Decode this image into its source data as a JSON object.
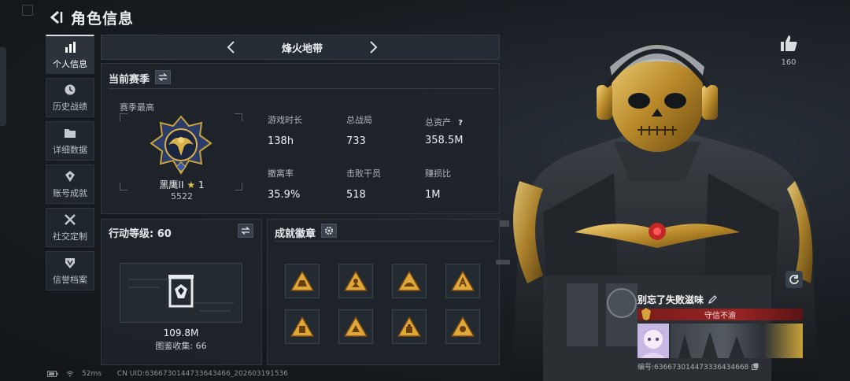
{
  "header": {
    "title": "角色信息"
  },
  "nav": {
    "items": [
      {
        "label": "个人信息"
      },
      {
        "label": "历史战绩"
      },
      {
        "label": "详细数据"
      },
      {
        "label": "账号成就"
      },
      {
        "label": "社交定制"
      },
      {
        "label": "信誉档案"
      }
    ]
  },
  "season": {
    "map_name": "烽火地带",
    "current_label": "当前赛季",
    "best_label": "赛季最高",
    "rank_name": "黑鹰II",
    "rank_stars": "1",
    "rank_score": "5522",
    "stats": [
      {
        "label": "游戏时长",
        "value": "138h"
      },
      {
        "label": "总战局",
        "value": "733"
      },
      {
        "label": "总资产",
        "value": "358.5M"
      },
      {
        "label": "撤离率",
        "value": "35.9%"
      },
      {
        "label": "击败干员",
        "value": "518"
      },
      {
        "label": "赚损比",
        "value": "1M"
      }
    ]
  },
  "action_level": {
    "title": "行动等级: 60",
    "value": "109.8M",
    "collection": "图鉴收集: 66"
  },
  "achievements": {
    "title": "成就徽章",
    "count": 8
  },
  "like": {
    "count": "160"
  },
  "player": {
    "name": "别忘了失败滋味",
    "title": "守信不渝",
    "id": "编号:636673014473336434668"
  },
  "status": {
    "ping": "52ms",
    "uid": "CN UID:6366730144733643466_202603191536"
  },
  "colors": {
    "accent_gold": "#c9a23a",
    "strip_red": "#8e2020"
  }
}
